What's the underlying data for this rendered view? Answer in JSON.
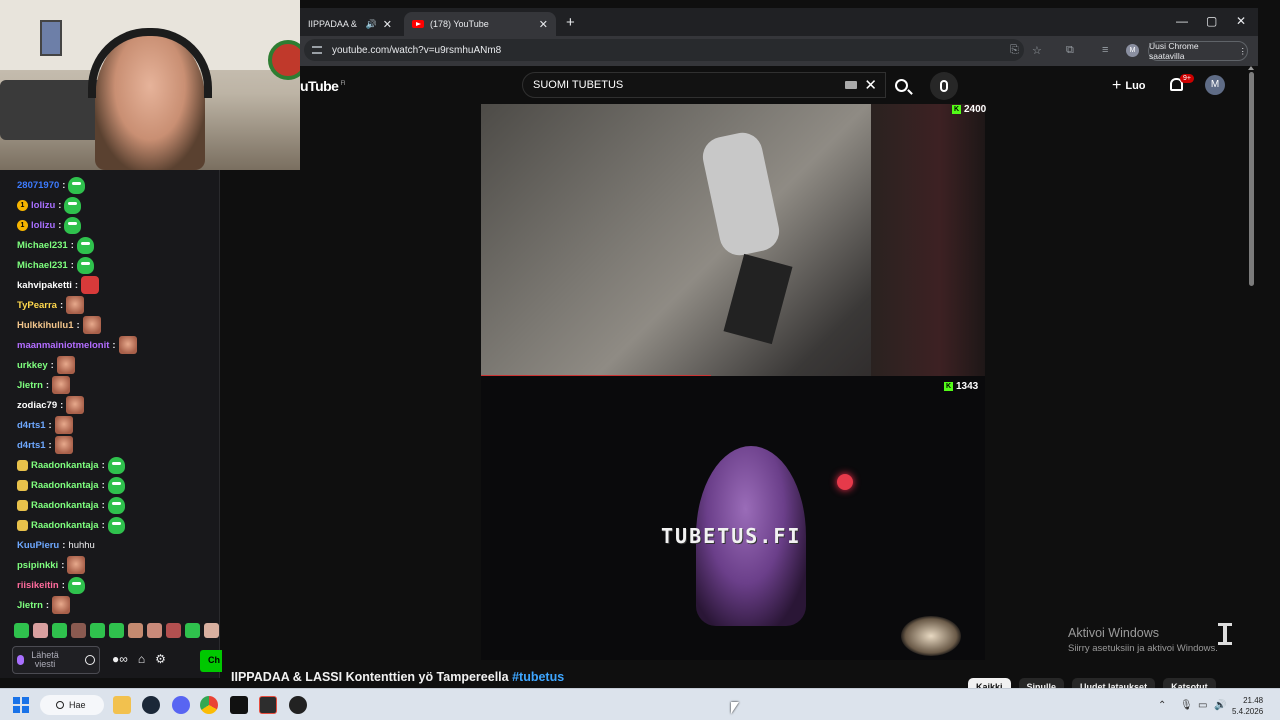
{
  "browser": {
    "tabs": [
      {
        "label": "IIPPADAA & LASSI Ko",
        "icon": "speaker-icon"
      },
      {
        "label": "(178) YouTube",
        "icon": "youtube-icon"
      }
    ],
    "url": "youtube.com/watch?v=u9rsmhuANm8",
    "update_label": "Uusi Chrome saatavilla",
    "profile_initial": "M"
  },
  "youtube": {
    "logo": "uTube",
    "logo_region": "FI",
    "search_value": "SUOMI TUBETUS",
    "create_label": "Luo",
    "notifications": "9+",
    "avatar_initial": "M",
    "video_title": "IIPPADAA & LASSI Kontenttien yö Tampereella",
    "video_hashtag": "#tubetus",
    "chips": [
      "Kaikki",
      "Sinulle",
      "Uudet lataukset",
      "Katsotut"
    ],
    "active_chip": "Kaikki"
  },
  "video": {
    "watermark": "TUBETUS.FI",
    "top_viewers": "2400",
    "bottom_viewers": "1343"
  },
  "chat": {
    "messages": [
      {
        "user": "28071970",
        "color": "#3d7bff",
        "badge": "",
        "msg": "",
        "emote": "green"
      },
      {
        "user": "lolizu",
        "color": "#a970ff",
        "badge": "coin",
        "msg": "",
        "emote": "green"
      },
      {
        "user": "lolizu",
        "color": "#a970ff",
        "badge": "coin",
        "msg": "",
        "emote": "green"
      },
      {
        "user": "Michael231",
        "color": "#7fff7f",
        "badge": "",
        "msg": "",
        "emote": "green"
      },
      {
        "user": "Michael231",
        "color": "#7fff7f",
        "badge": "",
        "msg": "",
        "emote": "green"
      },
      {
        "user": "kahvipaketti",
        "color": "#ffffff",
        "badge": "",
        "msg": "",
        "emote": "red"
      },
      {
        "user": "TyPearra",
        "color": "#ffd84d",
        "badge": "",
        "msg": "",
        "emote": "face"
      },
      {
        "user": "Hulkkihullu1",
        "color": "#f2c58c",
        "badge": "",
        "msg": "",
        "emote": "face"
      },
      {
        "user": "maanmainiotmelonit",
        "color": "#b36dff",
        "badge": "",
        "msg": "",
        "emote": "face"
      },
      {
        "user": "urkkey",
        "color": "#7fff7f",
        "badge": "",
        "msg": "",
        "emote": "face"
      },
      {
        "user": "Jietrn",
        "color": "#7fff7f",
        "badge": "",
        "msg": "",
        "emote": "face"
      },
      {
        "user": "zodiac79",
        "color": "#ffffff",
        "badge": "",
        "msg": "",
        "emote": "face"
      },
      {
        "user": "d4rts1",
        "color": "#6ea8ff",
        "badge": "",
        "msg": "",
        "emote": "face"
      },
      {
        "user": "d4rts1",
        "color": "#6ea8ff",
        "badge": "",
        "msg": "",
        "emote": "face"
      },
      {
        "user": "Raadonkantaja",
        "color": "#7fff7f",
        "badge": "hand",
        "msg": "",
        "emote": "green"
      },
      {
        "user": "Raadonkantaja",
        "color": "#7fff7f",
        "badge": "hand",
        "msg": "",
        "emote": "green"
      },
      {
        "user": "Raadonkantaja",
        "color": "#7fff7f",
        "badge": "hand",
        "msg": "",
        "emote": "green"
      },
      {
        "user": "Raadonkantaja",
        "color": "#7fff7f",
        "badge": "hand",
        "msg": "",
        "emote": "green"
      },
      {
        "user": "KuuPieru",
        "color": "#6ea8ff",
        "badge": "",
        "msg": "huhhu",
        "emote": ""
      },
      {
        "user": "psipinkki",
        "color": "#7fff7f",
        "badge": "",
        "msg": "",
        "emote": "face"
      },
      {
        "user": "riisikeitin",
        "color": "#ff6b9d",
        "badge": "",
        "msg": "",
        "emote": "green"
      },
      {
        "user": "Jietrn",
        "color": "#7fff7f",
        "badge": "",
        "msg": "",
        "emote": "face"
      }
    ],
    "input_placeholder": "Lähetä viesti",
    "send_label": "Ch"
  },
  "windows": {
    "activate_title": "Aktivoi Windows",
    "activate_sub": "Siirry asetuksiin ja aktivoi Windows.",
    "search_label": "Hae",
    "time": "21.48",
    "date": "5.4.2026"
  },
  "colors": {
    "kick_green": "#53fc18",
    "youtube_red": "#ff0000",
    "link_blue": "#3ea6ff"
  }
}
